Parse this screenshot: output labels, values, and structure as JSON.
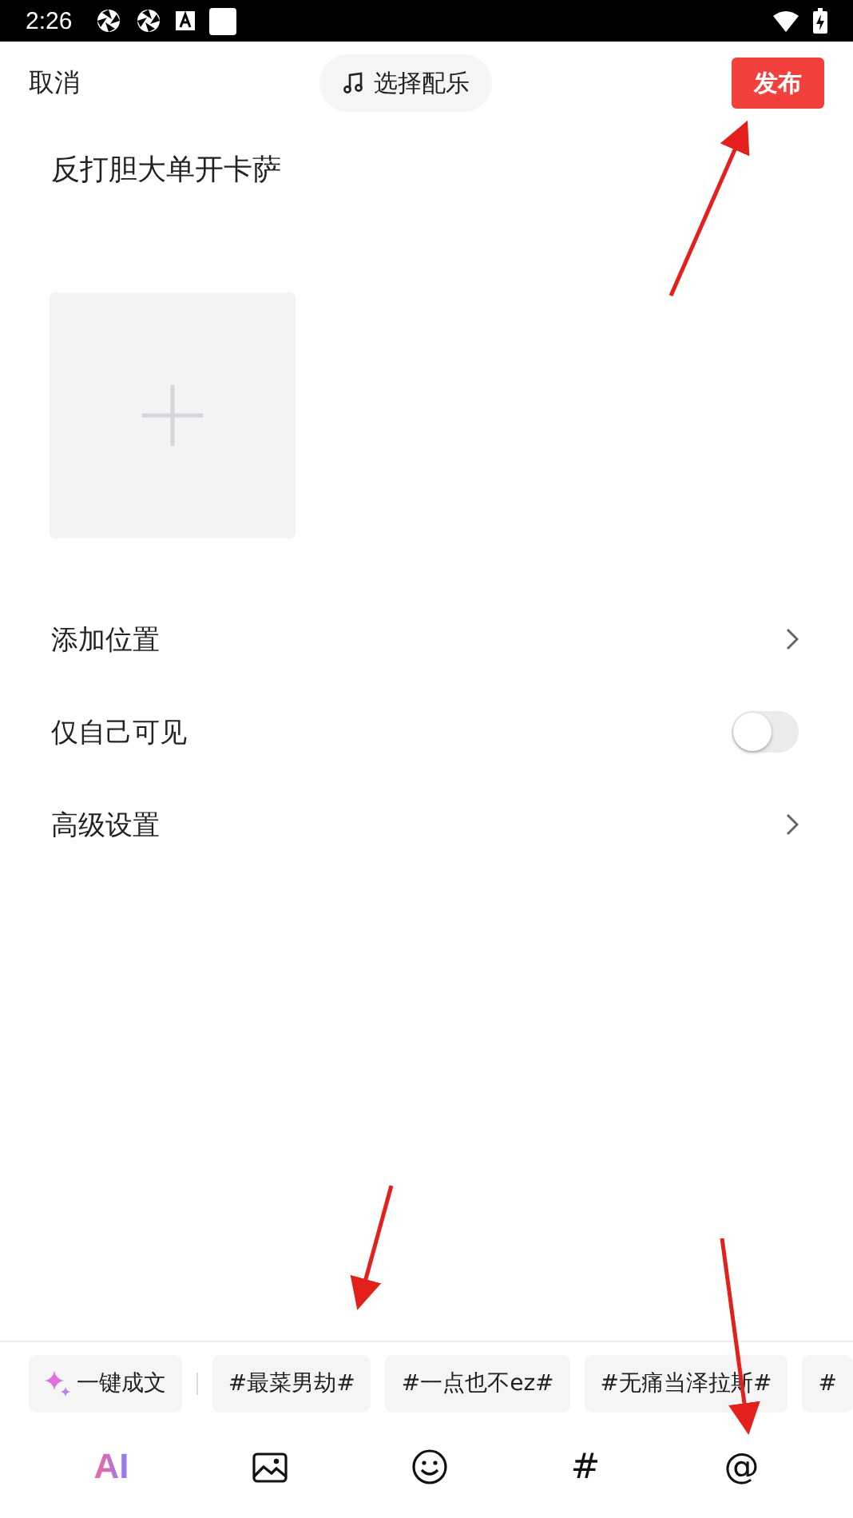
{
  "status_bar": {
    "time": "2:26"
  },
  "top_bar": {
    "cancel": "取消",
    "music": "选择配乐",
    "publish": "发布"
  },
  "post": {
    "text": "反打胆大单开卡萨"
  },
  "settings": [
    {
      "kind": "link",
      "label": "添加位置"
    },
    {
      "kind": "toggle",
      "label": "仅自己可见",
      "on": false
    },
    {
      "kind": "link",
      "label": "高级设置"
    }
  ],
  "suggestions": {
    "ai": "一键成文",
    "topics": [
      "#最菜男劫#",
      "#一点也不ez#",
      "#无痛当泽拉斯#",
      "#"
    ]
  },
  "toolbar": {
    "ai": "AI",
    "topic": "#",
    "mention": "@"
  }
}
